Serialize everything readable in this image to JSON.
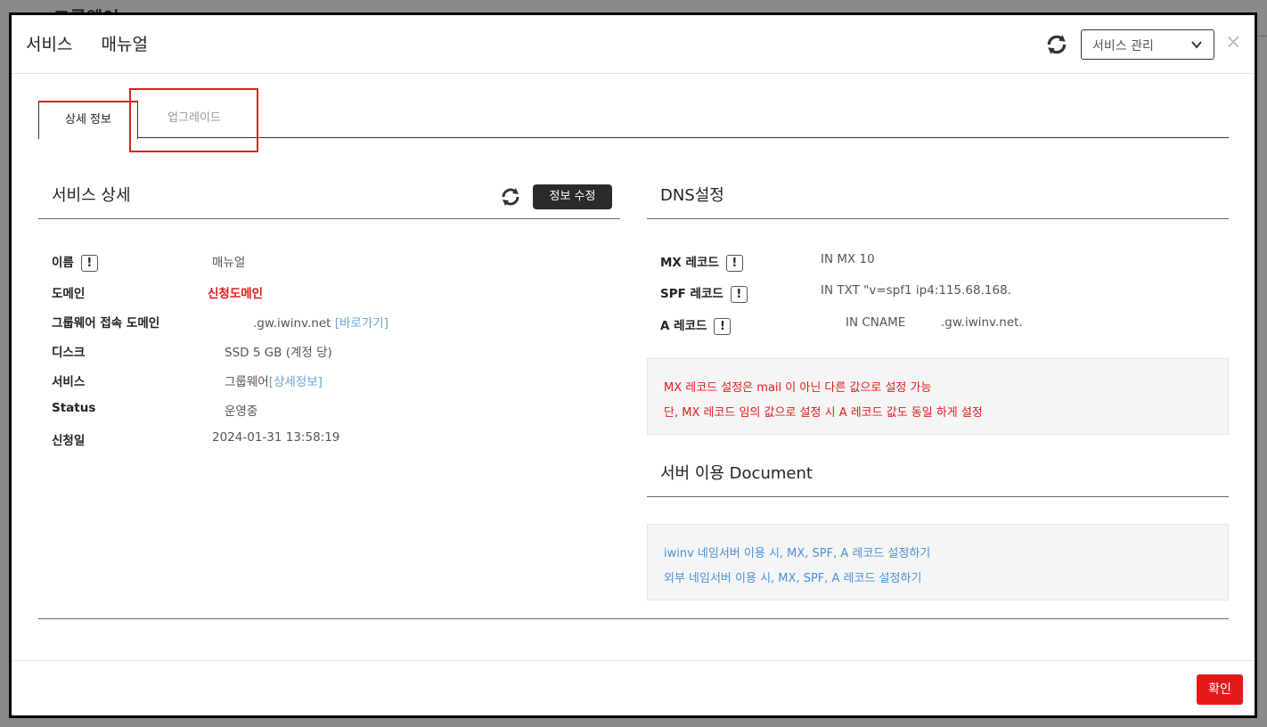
{
  "backdrop": {
    "title": "그룹웨어"
  },
  "header": {
    "title_service": "서비스",
    "title_name": "매뉴얼",
    "select_value": "서비스 관리",
    "close_symbol": "×"
  },
  "tabs": [
    {
      "label": "상세 정보",
      "active": true
    },
    {
      "label": "업그레이드",
      "active": false
    }
  ],
  "service_detail": {
    "title": "서비스 상세",
    "edit_button": "정보 수정",
    "rows": [
      {
        "label": "이름",
        "value": "매뉴얼",
        "has_info": true
      },
      {
        "label": "도메인",
        "value": "신청도메인"
      },
      {
        "label": "그룹웨어 접속 도메인",
        "value": ".gw.iwinv.net",
        "link": "[바로가기]"
      },
      {
        "label": "디스크",
        "value": "SSD 5 GB (계정 당)"
      },
      {
        "label": "서비스",
        "value": "그룹웨어",
        "link": "[상세정보]"
      },
      {
        "label": "Status",
        "value": "운영중"
      },
      {
        "label": "신청일",
        "value": "2024-01-31 13:58:19"
      }
    ]
  },
  "dns": {
    "title": "DNS설정",
    "rows": [
      {
        "label": "MX 레코드",
        "value": "IN MX 10"
      },
      {
        "label": "SPF 레코드",
        "value": "IN TXT \"v=spf1 ip4:115.68.168."
      },
      {
        "label": "A 레코드",
        "value": "IN CNAME",
        "value2": ".gw.iwinv.net."
      }
    ],
    "notes": [
      "MX 레코드 설정은 mail 이 아닌 다른 값으로 설정 가능",
      "단, MX 레코드 임의 값으로 설정 시 A 레코드 값도 동일 하게 설정"
    ]
  },
  "documents": {
    "title": "서버 이용 Document",
    "links": [
      "iwinv 네임서버 이용 시, MX, SPF, A 레코드 설정하기",
      "외부 네임서버 이용 시, MX, SPF, A 레코드 설정하기"
    ]
  },
  "footer": {
    "confirm_label": "확인"
  },
  "colors": {
    "accent": "#e41a1a",
    "link": "#4a90d9",
    "dark_button": "#2b2b2b"
  },
  "icons": [
    "refresh-icon",
    "chevron-down-icon",
    "close-icon",
    "info-exclamation-icon"
  ]
}
